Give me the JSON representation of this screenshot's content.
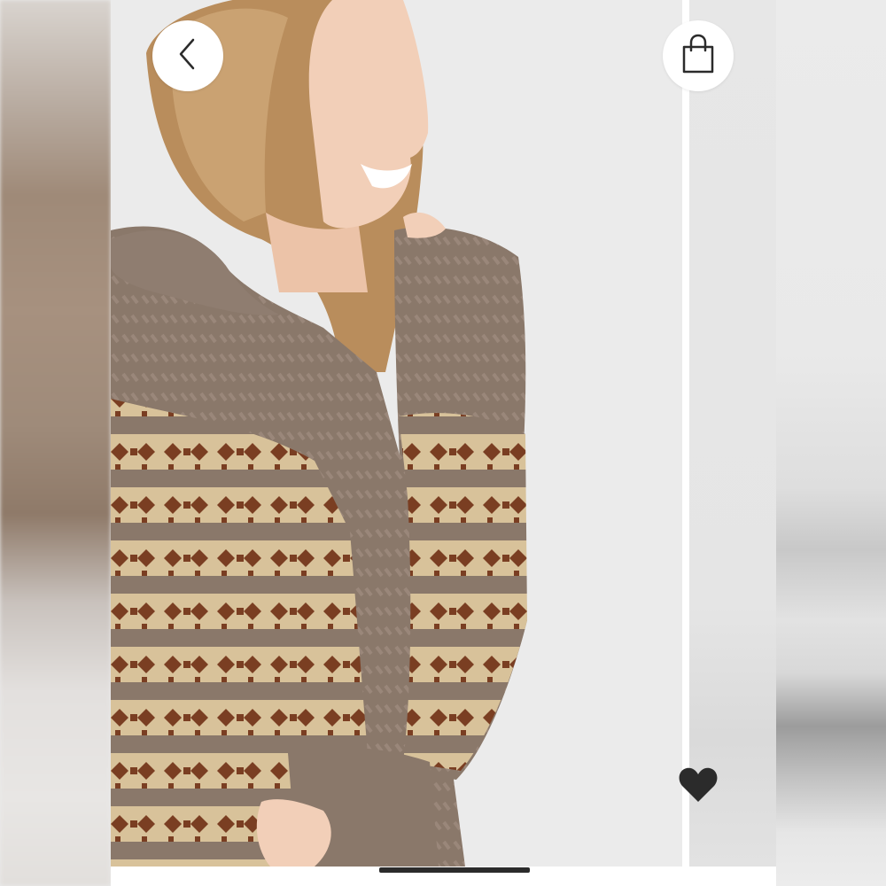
{
  "controls": {
    "back_icon": "chevron-left-icon",
    "bag_icon": "shopping-bag-icon",
    "favorite_icon": "heart-icon"
  },
  "gallery": {
    "active_image_index": 1
  },
  "colors": {
    "button_bg": "#ffffff",
    "icon_color": "#2b2b2b",
    "heart_color": "#2b2b2b",
    "sweater_base": "#8c7a6c",
    "sweater_pattern": "#7a3e22",
    "sweater_cream": "#d8c29a",
    "hair": "#b98d5c"
  }
}
